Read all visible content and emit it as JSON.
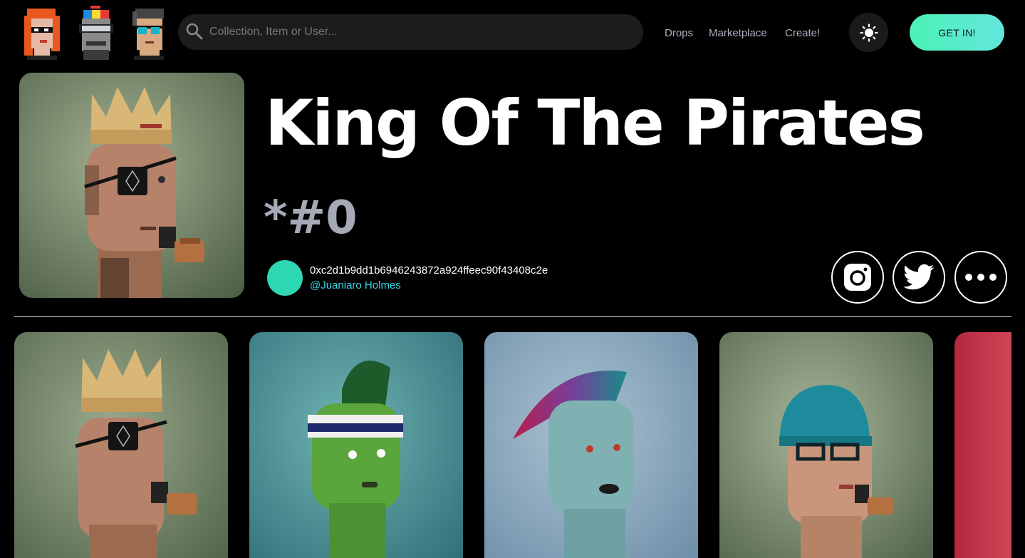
{
  "header": {
    "logo_icons": [
      "red-hair-punk-icon",
      "propeller-cap-punk-icon",
      "glasses-punk-icon"
    ],
    "search": {
      "placeholder": "Collection, Item or User...",
      "value": ""
    },
    "nav": [
      {
        "label": "Drops"
      },
      {
        "label": "Marketplace"
      },
      {
        "label": "Create!"
      }
    ],
    "theme_toggle_icon": "sun-icon",
    "cta_label": "GET IN!",
    "cta_gradient": [
      "#4cf2b7",
      "#63e6dc"
    ]
  },
  "item": {
    "title": "King Of The Pirates",
    "token_id": "*#0",
    "owner_address": "0xc2d1b9dd1b6946243872a924ffeec90f43408c2e",
    "owner_handle": "@Juaniaro Holmes",
    "owner_avatar_color": "#2ed7b3",
    "handle_color": "#3ad6e8",
    "socials": [
      {
        "name": "instagram-icon"
      },
      {
        "name": "twitter-icon"
      },
      {
        "name": "more-options-icon"
      }
    ]
  },
  "cards": [
    {
      "name": "pirate-king-card",
      "bg": [
        "#9aa98d",
        "#4f6247"
      ]
    },
    {
      "name": "green-mohawk-card",
      "bg": [
        "#6fb3b2",
        "#2e6c77"
      ]
    },
    {
      "name": "rainbow-hair-card",
      "bg": [
        "#aac2d1",
        "#6b8ca6"
      ]
    },
    {
      "name": "teal-beanie-card",
      "bg": [
        "#a8b79a",
        "#4d5f48"
      ]
    },
    {
      "name": "red-card",
      "bg": [
        "#e05467",
        "#b2283c"
      ]
    }
  ],
  "colors": {
    "background": "#000000",
    "nav_text": "#aab0bf",
    "token_id": "#a6a9b6",
    "search_bg": "#1c1c1c"
  }
}
